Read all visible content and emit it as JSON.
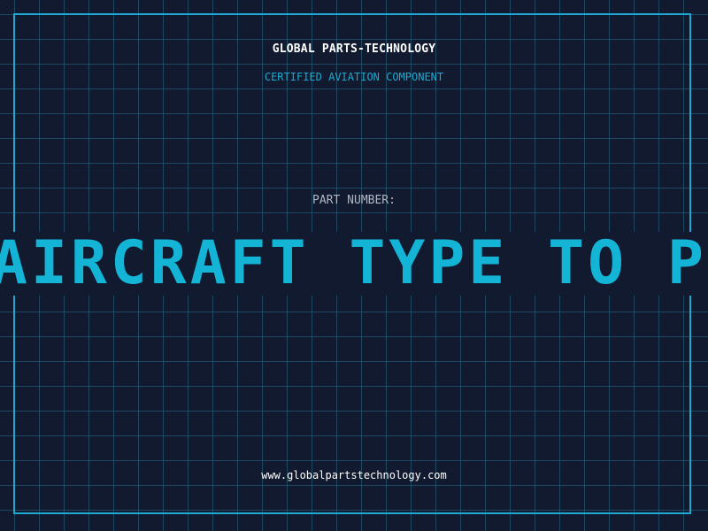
{
  "header": {
    "company": "GLOBAL PARTS-TECHNOLOGY",
    "subtitle": "CERTIFIED AVIATION COMPONENT"
  },
  "part": {
    "label": "PART NUMBER:",
    "value": "AIRCRAFT TYPE TO P"
  },
  "footer": {
    "website": "www.globalpartstechnology.com"
  },
  "colors": {
    "background": "#111a2e",
    "grid": "#286e87",
    "accent": "#1ea9d0",
    "part_text": "#13b4d6",
    "label_text": "#aeb7c6"
  }
}
